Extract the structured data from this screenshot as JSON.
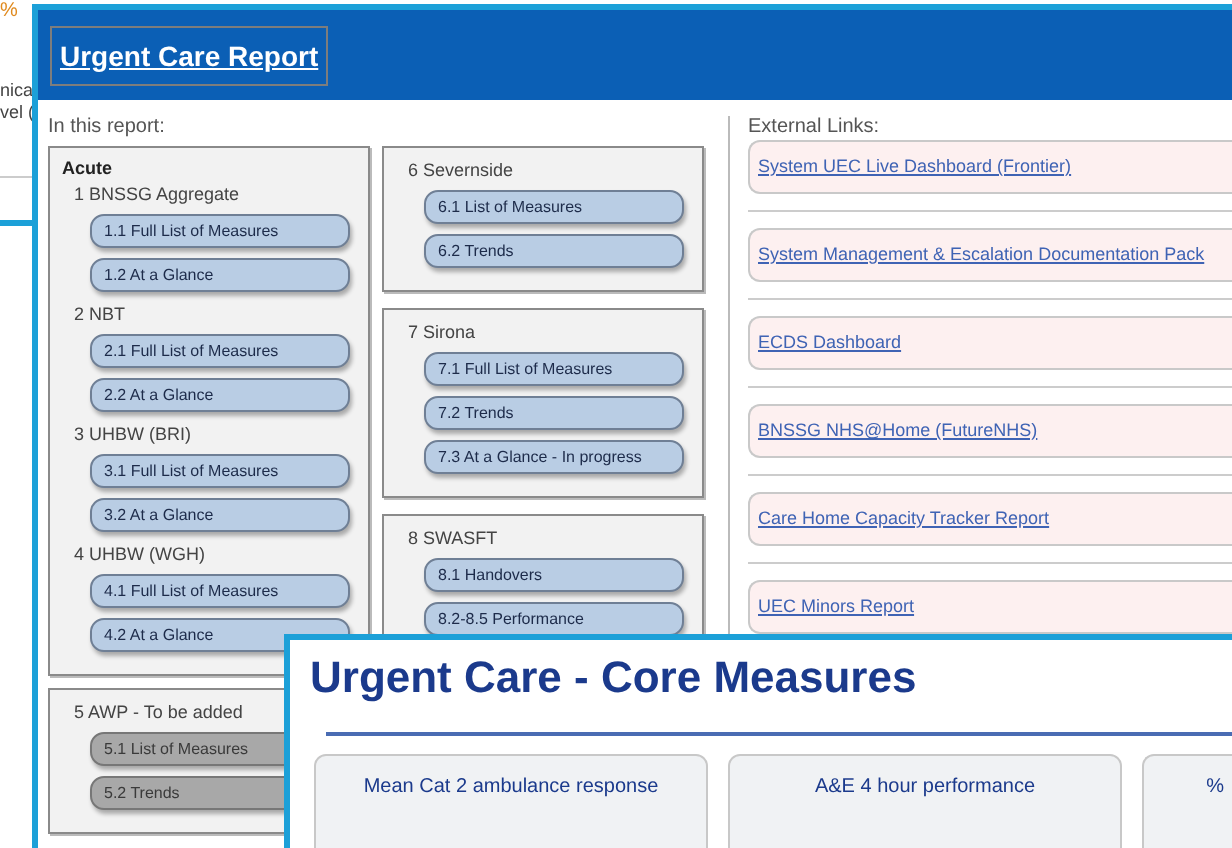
{
  "background_window": {
    "texts": [
      {
        "text": "%",
        "kind": "accent"
      },
      {
        "text": "nica",
        "kind": "plain"
      },
      {
        "text": "vel (",
        "kind": "plain"
      }
    ]
  },
  "report_window": {
    "title": "Urgent Care Report",
    "contents_heading": "In this report:",
    "columns": [
      {
        "boxes": [
          {
            "heading": "Acute",
            "groups": [
              {
                "title": "1 BNSSG Aggregate",
                "buttons": [
                  {
                    "label": "1.1 Full List of Measures",
                    "disabled": false
                  },
                  {
                    "label": "1.2 At a Glance",
                    "disabled": false
                  }
                ]
              },
              {
                "title": "2 NBT",
                "buttons": [
                  {
                    "label": "2.1 Full List of Measures",
                    "disabled": false
                  },
                  {
                    "label": "2.2 At a Glance",
                    "disabled": false
                  }
                ]
              },
              {
                "title": "3 UHBW (BRI)",
                "buttons": [
                  {
                    "label": "3.1 Full List of Measures",
                    "disabled": false
                  },
                  {
                    "label": "3.2 At a Glance",
                    "disabled": false
                  }
                ]
              },
              {
                "title": "4 UHBW (WGH)",
                "buttons": [
                  {
                    "label": "4.1 Full List of Measures",
                    "disabled": false
                  },
                  {
                    "label": "4.2 At a Glance",
                    "disabled": false
                  }
                ]
              }
            ]
          },
          {
            "groups": [
              {
                "title": "5 AWP - To be added",
                "buttons": [
                  {
                    "label": "5.1 List of Measures",
                    "disabled": true
                  },
                  {
                    "label": "5.2 Trends",
                    "disabled": true
                  }
                ]
              }
            ]
          }
        ]
      },
      {
        "boxes": [
          {
            "groups": [
              {
                "title": "6 Severnside",
                "buttons": [
                  {
                    "label": "6.1 List of Measures",
                    "disabled": false
                  },
                  {
                    "label": "6.2 Trends",
                    "disabled": false
                  }
                ]
              }
            ]
          },
          {
            "groups": [
              {
                "title": "7 Sirona",
                "buttons": [
                  {
                    "label": "7.1 Full List of Measures",
                    "disabled": false
                  },
                  {
                    "label": "7.2 Trends",
                    "disabled": false
                  },
                  {
                    "label": "7.3 At a Glance - In progress",
                    "disabled": false
                  }
                ]
              }
            ]
          },
          {
            "groups": [
              {
                "title": "8 SWASFT",
                "buttons": [
                  {
                    "label": "8.1 Handovers",
                    "disabled": false
                  },
                  {
                    "label": "8.2-8.5 Performance",
                    "disabled": false
                  }
                ]
              }
            ]
          }
        ]
      }
    ],
    "external_links_heading": "External Links:",
    "external_links": [
      "System UEC Live Dashboard (Frontier)",
      "System Management & Escalation Documentation Pack",
      "ECDS Dashboard",
      "BNSSG NHS@Home (FutureNHS)",
      "Care Home Capacity Tracker Report",
      "UEC Minors Report"
    ]
  },
  "core_measures_window": {
    "title": "Urgent Care - Core Measures",
    "cards": [
      {
        "title": "Mean Cat 2 ambulance response"
      },
      {
        "title": "A&E 4 hour performance"
      },
      {
        "title": "%"
      }
    ]
  }
}
